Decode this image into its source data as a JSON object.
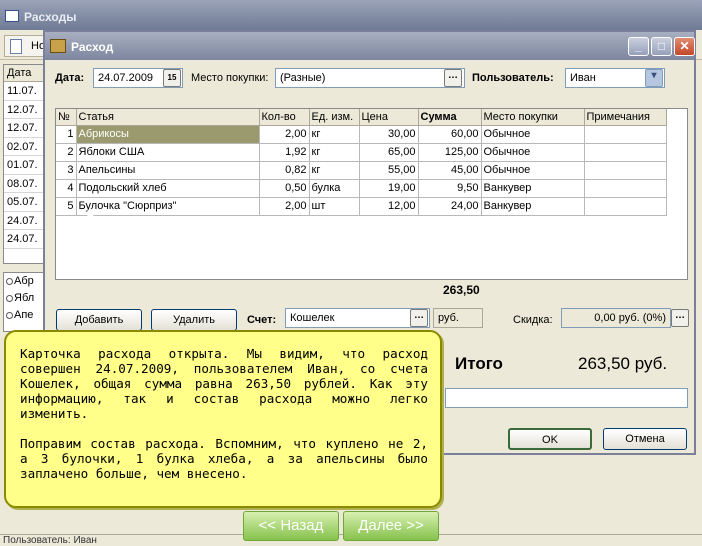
{
  "main_window": {
    "title": "Расходы",
    "new_button": "Но",
    "list_header": "Дата",
    "list_rows": [
      "11.07.",
      "12.07.",
      "12.07.",
      "02.07.",
      "01.07.",
      "08.07.",
      "05.07.",
      "24.07.",
      "24.07."
    ],
    "tree_items": [
      "Абр",
      "Ябл",
      "Апе"
    ],
    "status": "Пользователь: Иван"
  },
  "dialog": {
    "title": "Расход",
    "date_label": "Дата:",
    "date_value": "24.07.2009",
    "calendar_icon": "15",
    "place_label": "Место покупки:",
    "place_value": "(Разные)",
    "user_label": "Пользователь:",
    "user_value": "Иван",
    "columns": [
      "№",
      "Статья",
      "Кол-во",
      "Ед. изм.",
      "Цена",
      "Сумма",
      "Место покупки",
      "Примечания"
    ],
    "rows": [
      {
        "n": "1",
        "item": "Абрикосы",
        "qty": "2,00",
        "unit": "кг",
        "price": "30,00",
        "sum": "60,00",
        "place": "Обычное",
        "note": ""
      },
      {
        "n": "2",
        "item": "Яблоки США",
        "qty": "1,92",
        "unit": "кг",
        "price": "65,00",
        "sum": "125,00",
        "place": "Обычное",
        "note": ""
      },
      {
        "n": "3",
        "item": "Апельсины",
        "qty": "0,82",
        "unit": "кг",
        "price": "55,00",
        "sum": "45,00",
        "place": "Обычное",
        "note": ""
      },
      {
        "n": "4",
        "item": "Подольский хлеб",
        "qty": "0,50",
        "unit": "булка",
        "price": "19,00",
        "sum": "9,50",
        "place": "Ванкувер",
        "note": ""
      },
      {
        "n": "5",
        "item": "Булочка \"Сюрприз\"",
        "qty": "2,00",
        "unit": "шт",
        "price": "12,00",
        "sum": "24,00",
        "place": "Ванкувер",
        "note": ""
      }
    ],
    "total": "263,50",
    "add_button": "Добавить",
    "delete_button": "Удалить",
    "account_label": "Счет:",
    "account_value": "Кошелек",
    "currency": "руб.",
    "discount_label": "Скидка:",
    "discount_value": "0,00 руб. (0%)",
    "itogo_label": "Итого",
    "itogo_value": "263,50 руб.",
    "ok_button": "OK",
    "cancel_button": "Отмена"
  },
  "tooltip": {
    "p1": "Карточка расхода открыта. Мы видим, что расход совершен 24.07.2009, пользователем Иван, со счета Кошелек, общая сумма равна 263,50 рублей. Как эту информацию, так и состав расхода можно легко изменить.",
    "p2": "Поправим состав расхода. Вспомним, что куплено не 2, а 3 булочки, 1 булка хлеба, а за апельсины было заплачено больше, чем внесено."
  },
  "nav": {
    "back": "<< Назад",
    "next": "Далее >>"
  }
}
